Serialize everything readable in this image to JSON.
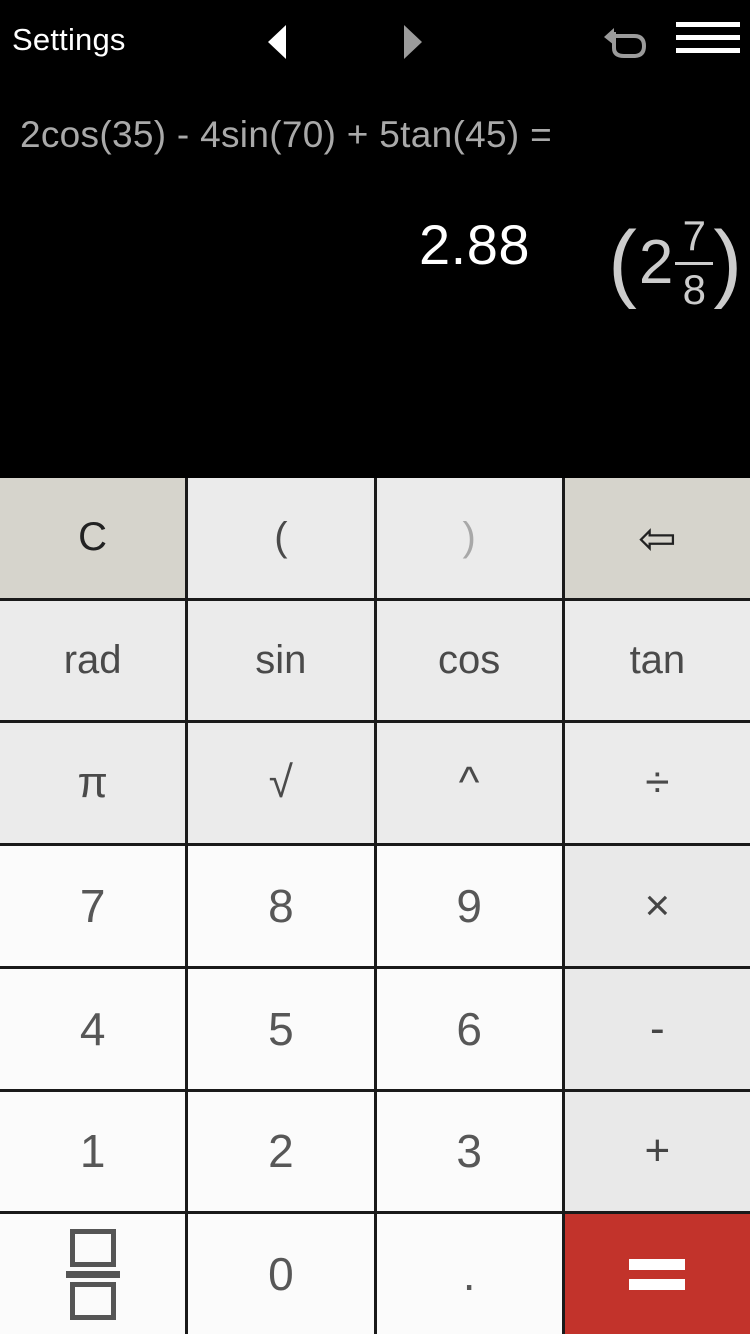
{
  "header": {
    "settings_label": "Settings",
    "prev_icon": "triangle-left-icon",
    "next_icon": "triangle-right-icon",
    "undo_icon": "undo-arrow-icon",
    "menu_icon": "hamburger-menu-icon",
    "prev_color": "#ffffff",
    "next_color": "#9b9b9b",
    "undo_color": "#9b9b9b"
  },
  "display": {
    "expression": "2cos(35) - 4sin(70) + 5tan(45) =",
    "result": "2.88",
    "fraction": {
      "open_paren": "(",
      "whole": "2",
      "numerator": "7",
      "denominator": "8",
      "close_paren": ")"
    },
    "background": "#000000",
    "expression_color": "#a9a9a9",
    "result_color": "#ffffff",
    "fraction_color": "#cccccc"
  },
  "keypad": {
    "rows": [
      [
        {
          "label": "C",
          "name": "clear-button",
          "style": "func"
        },
        {
          "label": "(",
          "name": "open-paren-button",
          "style": "light"
        },
        {
          "label": ")",
          "name": "close-paren-button",
          "style": "light dim"
        },
        {
          "label": "",
          "name": "backspace-button",
          "style": "func",
          "icon": "backspace-left-arrow-icon"
        }
      ],
      [
        {
          "label": "rad",
          "name": "rad-button",
          "style": "light trig"
        },
        {
          "label": "sin",
          "name": "sin-button",
          "style": "light trig"
        },
        {
          "label": "cos",
          "name": "cos-button",
          "style": "light trig"
        },
        {
          "label": "tan",
          "name": "tan-button",
          "style": "light trig"
        }
      ],
      [
        {
          "label": "π",
          "name": "pi-button",
          "style": "light sym"
        },
        {
          "label": "√",
          "name": "sqrt-button",
          "style": "light sym"
        },
        {
          "label": "^",
          "name": "power-button",
          "style": "light sym"
        },
        {
          "label": "÷",
          "name": "divide-button",
          "style": "light sym"
        }
      ],
      [
        {
          "label": "7",
          "name": "digit-7-button",
          "style": "digit"
        },
        {
          "label": "8",
          "name": "digit-8-button",
          "style": "digit"
        },
        {
          "label": "9",
          "name": "digit-9-button",
          "style": "digit"
        },
        {
          "label": "×",
          "name": "multiply-button",
          "style": "op"
        }
      ],
      [
        {
          "label": "4",
          "name": "digit-4-button",
          "style": "digit"
        },
        {
          "label": "5",
          "name": "digit-5-button",
          "style": "digit"
        },
        {
          "label": "6",
          "name": "digit-6-button",
          "style": "digit"
        },
        {
          "label": "-",
          "name": "minus-button",
          "style": "op"
        }
      ],
      [
        {
          "label": "1",
          "name": "digit-1-button",
          "style": "digit"
        },
        {
          "label": "2",
          "name": "digit-2-button",
          "style": "digit"
        },
        {
          "label": "3",
          "name": "digit-3-button",
          "style": "digit"
        },
        {
          "label": "+",
          "name": "plus-button",
          "style": "op"
        }
      ],
      [
        {
          "label": "",
          "name": "fraction-button",
          "style": "digit",
          "icon": "fraction-boxes-icon"
        },
        {
          "label": "0",
          "name": "digit-0-button",
          "style": "digit"
        },
        {
          "label": ".",
          "name": "decimal-point-button",
          "style": "digit"
        },
        {
          "label": "",
          "name": "equals-button",
          "style": "equals",
          "icon": "equals-sign-icon"
        }
      ]
    ],
    "colors": {
      "function_key": "#d6d4cc",
      "light_key": "#ebebeb",
      "digit_key": "#fbfbfb",
      "operator_key": "#e9e9e9",
      "equals_key": "#c2332b",
      "grid_line": "#1a1a1a"
    }
  }
}
